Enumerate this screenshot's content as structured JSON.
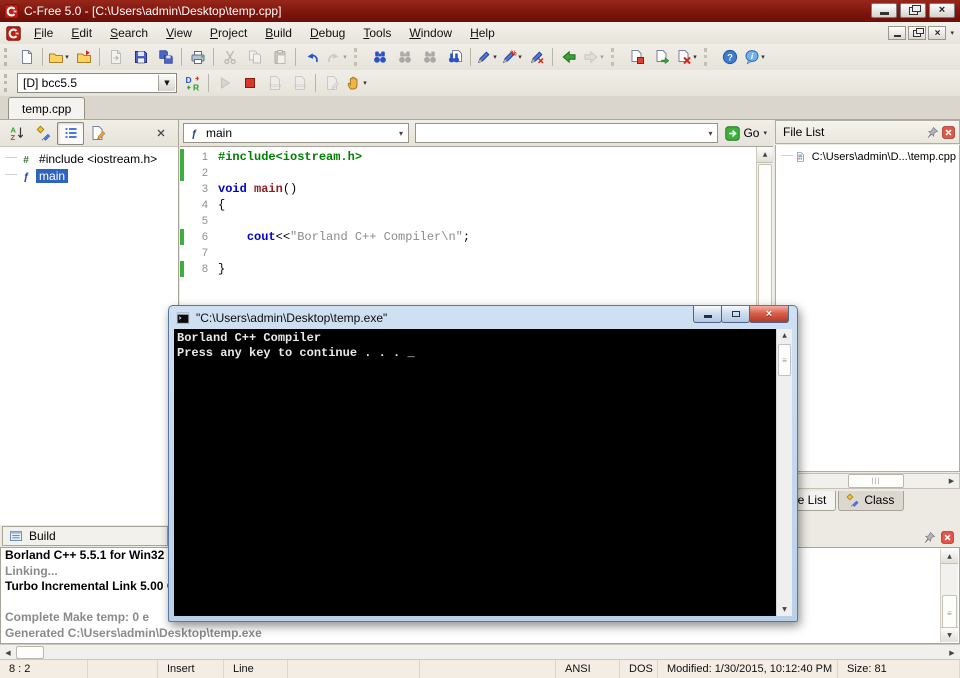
{
  "window": {
    "title": "C-Free 5.0 - [C:\\Users\\admin\\Desktop\\temp.cpp]",
    "controls": [
      "minimize",
      "restore",
      "close"
    ]
  },
  "menu": {
    "items": [
      "File",
      "Edit",
      "Search",
      "View",
      "Project",
      "Build",
      "Debug",
      "Tools",
      "Window",
      "Help"
    ]
  },
  "colors": {
    "titlebar": "#7c150c",
    "selection": "#2f63c0",
    "change_bar": "#3fae3f",
    "console_bg": "#000000",
    "console_text": "#e9e9e9",
    "keyword": "#0000cc",
    "preprocessor": "#008000",
    "function_name": "#8e2020",
    "string": "#8a8a8a"
  },
  "toolbar_main": {
    "items": [
      {
        "t": "b",
        "name": "new-file",
        "icon": "page"
      },
      {
        "t": "s"
      },
      {
        "t": "b",
        "name": "open-file",
        "icon": "folder",
        "dropdown": true
      },
      {
        "t": "b",
        "name": "reopen-file",
        "icon": "folder-arrow"
      },
      {
        "t": "s"
      },
      {
        "t": "b",
        "name": "close-file",
        "icon": "page-arrow",
        "disabled": true
      },
      {
        "t": "b",
        "name": "save",
        "icon": "disk"
      },
      {
        "t": "b",
        "name": "save-all",
        "icon": "disks"
      },
      {
        "t": "s"
      },
      {
        "t": "b",
        "name": "print",
        "icon": "printer"
      },
      {
        "t": "s"
      },
      {
        "t": "b",
        "name": "cut",
        "icon": "scissors",
        "disabled": true
      },
      {
        "t": "b",
        "name": "copy",
        "icon": "copy",
        "disabled": true
      },
      {
        "t": "b",
        "name": "paste",
        "icon": "paste",
        "disabled": true
      },
      {
        "t": "s"
      },
      {
        "t": "b",
        "name": "undo",
        "icon": "undo"
      },
      {
        "t": "b",
        "name": "redo",
        "icon": "redo",
        "disabled": true,
        "dropdown": true
      },
      {
        "t": "g"
      },
      {
        "t": "b",
        "name": "find",
        "icon": "binoculars"
      },
      {
        "t": "b",
        "name": "find-next",
        "icon": "binoculars",
        "disabled": true
      },
      {
        "t": "b",
        "name": "find-previous",
        "icon": "binoculars",
        "disabled": true
      },
      {
        "t": "b",
        "name": "find-in-files",
        "icon": "binoculars-page"
      },
      {
        "t": "s"
      },
      {
        "t": "b",
        "name": "toggle-bookmark",
        "icon": "pen",
        "dropdown": true
      },
      {
        "t": "b",
        "name": "goto-bookmark",
        "icon": "pen-percent",
        "dropdown": true
      },
      {
        "t": "b",
        "name": "clear-bookmarks",
        "icon": "pen-cross"
      },
      {
        "t": "s"
      },
      {
        "t": "b",
        "name": "navigate-back",
        "icon": "arrow-left-green"
      },
      {
        "t": "b",
        "name": "navigate-forward",
        "icon": "arrow-right-gray",
        "disabled": true,
        "dropdown": true
      },
      {
        "t": "g"
      },
      {
        "t": "b",
        "name": "compile",
        "icon": "page-compile"
      },
      {
        "t": "b",
        "name": "build-file",
        "icon": "page-build"
      },
      {
        "t": "b",
        "name": "rebuild-all",
        "icon": "page-rebuild",
        "dropdown": true
      },
      {
        "t": "g"
      },
      {
        "t": "b",
        "name": "help",
        "icon": "help-circle"
      },
      {
        "t": "b",
        "name": "about",
        "icon": "info-balloon",
        "dropdown": true
      }
    ]
  },
  "toolbar_build": {
    "items": [
      {
        "t": "combo",
        "name": "build-configuration-combo",
        "value": "[D] bcc5.5",
        "width": 160
      },
      {
        "t": "b",
        "name": "debug-release-toggle",
        "icon": "dr-toggle"
      },
      {
        "t": "s"
      },
      {
        "t": "b",
        "name": "run",
        "icon": "play",
        "disabled": true
      },
      {
        "t": "b",
        "name": "stop",
        "icon": "stop"
      },
      {
        "t": "b",
        "name": "run-to-cursor",
        "icon": "page-1010",
        "disabled": true
      },
      {
        "t": "b",
        "name": "show-assembly",
        "icon": "page-1010",
        "disabled": true
      },
      {
        "t": "s"
      },
      {
        "t": "b",
        "name": "edit-watch",
        "icon": "page-pen",
        "disabled": true
      },
      {
        "t": "b",
        "name": "pause",
        "icon": "hand",
        "dropdown": true
      }
    ]
  },
  "tab_bar": {
    "tabs": [
      {
        "label": "temp.cpp",
        "active": true
      }
    ]
  },
  "symbol_panel": {
    "buttons": [
      {
        "name": "sort-symbols",
        "icon": "sort-az"
      },
      {
        "name": "class-view",
        "icon": "class-shapes"
      },
      {
        "name": "list-view",
        "icon": "list-lines",
        "pressed": true
      },
      {
        "name": "view-options",
        "icon": "page-edit"
      }
    ],
    "close_button": {
      "name": "close-symbol-panel",
      "icon": "close-x"
    },
    "items": [
      {
        "icon": "hash-icon",
        "label": "#include <iostream.h>",
        "selected": false
      },
      {
        "icon": "func-f",
        "label": "main",
        "selected": true
      }
    ]
  },
  "editor": {
    "function_combo_value": "main",
    "search_combo_value": "",
    "go_label": "Go",
    "lines": [
      {
        "num": 1,
        "changed": true,
        "tokens": [
          {
            "text": "#include<iostream.h>",
            "style": "preproc"
          }
        ]
      },
      {
        "num": 2,
        "changed": true,
        "tokens": []
      },
      {
        "num": 3,
        "changed": false,
        "tokens": [
          {
            "text": "void",
            "style": "keyword"
          },
          {
            "text": " ",
            "style": "plain"
          },
          {
            "text": "main",
            "style": "function"
          },
          {
            "text": "()",
            "style": "plain"
          }
        ]
      },
      {
        "num": 4,
        "changed": false,
        "tokens": [
          {
            "text": "{",
            "style": "plain"
          }
        ]
      },
      {
        "num": 5,
        "changed": false,
        "tokens": []
      },
      {
        "num": 6,
        "changed": true,
        "tokens": [
          {
            "text": "    ",
            "style": "plain"
          },
          {
            "text": "cout",
            "style": "keyword"
          },
          {
            "text": "<<",
            "style": "plain"
          },
          {
            "text": "\"Borland C++ Compiler\\n\"",
            "style": "string"
          },
          {
            "text": ";",
            "style": "plain"
          }
        ]
      },
      {
        "num": 7,
        "changed": false,
        "tokens": []
      },
      {
        "num": 8,
        "changed": true,
        "tokens": [
          {
            "text": "}",
            "style": "plain"
          }
        ]
      }
    ]
  },
  "file_list_panel": {
    "title": "File List",
    "items": [
      {
        "icon": "file-page",
        "label": "C:\\Users\\admin\\D...\\temp.cpp",
        "selected": false
      }
    ],
    "bottom_tabs": [
      {
        "label": "File List",
        "active": true
      },
      {
        "label": "Class",
        "active": false,
        "icon": "class-shapes"
      }
    ]
  },
  "build_panel": {
    "title": "Build",
    "lines": [
      {
        "text": "Borland C++ 5.5.1 for Win32 C",
        "style": "black"
      },
      {
        "text": "Linking...",
        "style": "gray"
      },
      {
        "text": "Turbo Incremental Link 5.00 C",
        "style": "black"
      },
      {
        "text": "",
        "style": "gray"
      },
      {
        "text": "Complete Make temp: 0 e",
        "style": "gray"
      },
      {
        "text": "Generated C:\\Users\\admin\\Desktop\\temp.exe",
        "style": "gray"
      }
    ]
  },
  "status_bar": {
    "cells": [
      {
        "text": "8 : 2",
        "w": 88
      },
      {
        "text": "",
        "w": 70
      },
      {
        "text": "Insert",
        "w": 66
      },
      {
        "text": "Line",
        "w": 64
      },
      {
        "text": "",
        "w": 132
      },
      {
        "text": "",
        "w": 136
      },
      {
        "text": "ANSI",
        "w": 64
      },
      {
        "text": "DOS",
        "w": 38
      },
      {
        "text": "Modified: 1/30/2015, 10:12:40 PM",
        "w": 180
      },
      {
        "text": "Size: 81",
        "w": 122
      }
    ]
  },
  "console": {
    "title": "\"C:\\Users\\admin\\Desktop\\temp.exe\"",
    "lines": [
      "Borland C++ Compiler",
      "Press any key to continue . . . "
    ],
    "cursor": "_"
  }
}
